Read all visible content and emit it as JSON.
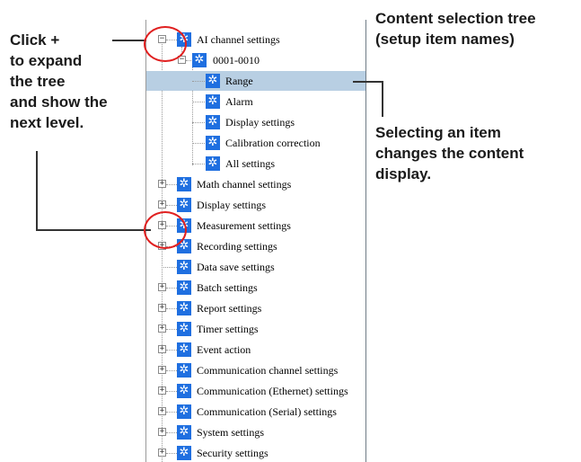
{
  "callouts": {
    "expand": [
      "Click +",
      "to expand",
      "the tree",
      "and show the",
      "next level."
    ],
    "tree_title": [
      "Content selection tree",
      "(setup item names)"
    ],
    "select": [
      "Selecting an item",
      "changes the content",
      "display."
    ]
  },
  "tree": {
    "ai_channel": "AI channel settings",
    "group_0001": "0001-0010",
    "range": "Range",
    "alarm": "Alarm",
    "display_settings_sub": "Display settings",
    "calibration": "Calibration correction",
    "all_settings": "All settings",
    "math_channel": "Math channel settings",
    "display_settings": "Display settings",
    "measurement": "Measurement settings",
    "recording": "Recording settings",
    "data_save": "Data save settings",
    "batch": "Batch settings",
    "report": "Report settings",
    "timer": "Timer settings",
    "event_action": "Event action",
    "comm_channel": "Communication channel settings",
    "comm_ethernet": "Communication (Ethernet) settings",
    "comm_serial": "Communication (Serial) settings",
    "system": "System settings",
    "security": "Security settings"
  },
  "colors": {
    "highlight_circle": "#e02020",
    "gear_icon": "#1f6fe0",
    "selected_row": "#b8cfe3"
  }
}
